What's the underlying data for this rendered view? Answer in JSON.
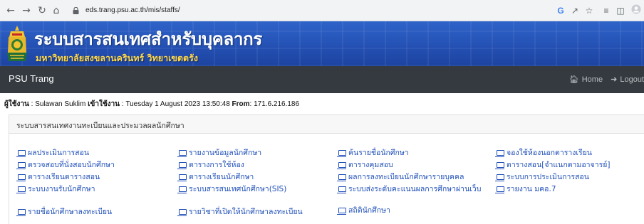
{
  "browser": {
    "url": "eds.trang.psu.ac.th/mis/staffs/"
  },
  "header": {
    "title": "ระบบสารสนเทศสำหรับบุคลากร",
    "subtitle": "มหาวิทยาลัยสงขลานครินทร์ วิทยาเขตตรัง"
  },
  "navbar": {
    "brand": "PSU Trang",
    "home": "Home",
    "logout": "Logout"
  },
  "user": {
    "user_label": "ผู้ใช้งาน",
    "user_name": ": Sulawan Suklim",
    "login_label": "เข้าใช้งาน",
    "login_time": ": Tuesday 1 August 2023 13:50:48",
    "from_label": "From",
    "from_ip": ": 171.6.216.186"
  },
  "panel": {
    "title": "ระบบสารสนเทศงานทะเบียนและประมวลผลนักศึกษา",
    "links": [
      "ผลประเมินการสอน",
      "รายงานข้อมูลนักศึกษา",
      "ค้นรายชื่อนักศึกษา",
      "จองใช้ห้องนอกตารางเรียน",
      "ตรวจสอบที่นั่งสอบนักศึกษา",
      "ตารางการใช้ห้อง",
      "ตารางคุมสอบ",
      "ตารางสอน[จำแนกตามอาจารย์]",
      "ตารางเรียนตารางสอน",
      "ตารางเรียนนักศึกษา",
      "ผลการลงทะเบียนนักศึกษารายบุคคล",
      "ระบบการประเมินการสอน",
      "ระบบงานรับนักศึกษา",
      "ระบบสารสนเทศนักศึกษา(SIS)",
      "ระบบส่งระดับคะแนนผลการศึกษาผ่านเว็บ",
      "รายงาน มคอ.7",
      "รายชื่อนักศึกษาลงทะเบียน",
      "รายวิชาที่เปิดให้นักศึกษาลงทะเบียน",
      "สถิตินักศึกษา"
    ]
  }
}
